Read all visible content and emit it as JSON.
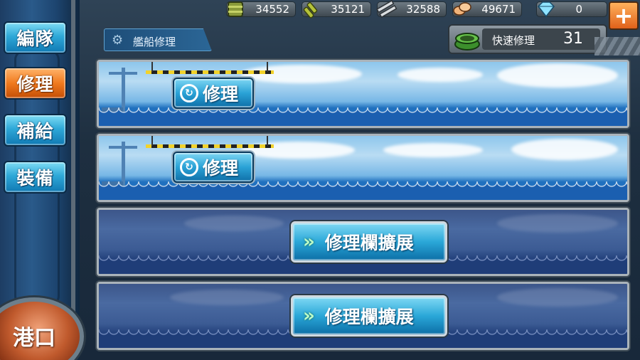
{
  "resources": {
    "fuel": {
      "value": "34552",
      "icon": "fuel-drum-icon"
    },
    "ammo": {
      "value": "35121",
      "icon": "ammo-icon"
    },
    "steel": {
      "value": "32588",
      "icon": "steel-icon"
    },
    "bauxite": {
      "value": "49671",
      "icon": "bauxite-icon"
    },
    "gems": {
      "value": "0",
      "icon": "diamond-icon"
    },
    "plus_label": "+"
  },
  "header": {
    "title": "艦船修理",
    "icon": "gear-icon"
  },
  "sidebar": {
    "tabs": [
      {
        "label": "編隊",
        "active": false
      },
      {
        "label": "修理",
        "active": true
      },
      {
        "label": "補給",
        "active": false
      },
      {
        "label": "裝備",
        "active": false
      }
    ],
    "port_label": "港口"
  },
  "quick_repair": {
    "label": "快速修理",
    "count": "31",
    "icon": "bucket-icon"
  },
  "docks": [
    {
      "state": "open",
      "button_label": "修理"
    },
    {
      "state": "open",
      "button_label": "修理"
    },
    {
      "state": "locked",
      "button_label": "修理欄擴展"
    },
    {
      "state": "locked",
      "button_label": "修理欄擴展"
    }
  ],
  "colors": {
    "accent_blue": "#2aa2d6",
    "active_orange": "#f07a1e",
    "port_copper": "#c05a2d"
  }
}
